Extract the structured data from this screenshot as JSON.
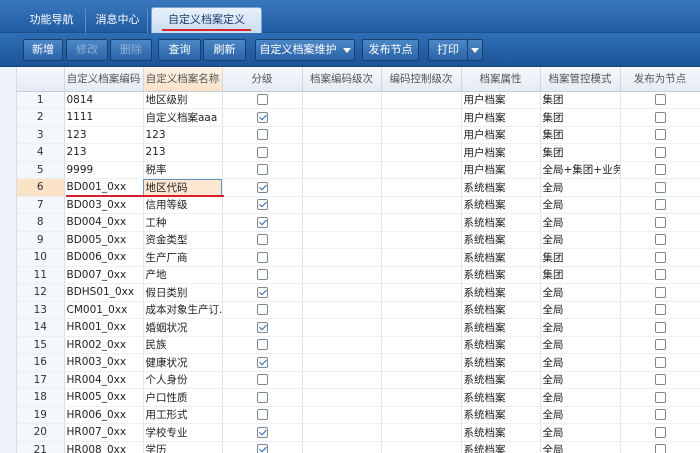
{
  "tabs": [
    {
      "label": "功能导航"
    },
    {
      "label": "消息中心"
    },
    {
      "label": "自定义档案定义"
    }
  ],
  "toolbar": {
    "add": "新增",
    "edit": "修改",
    "delete": "删除",
    "query": "查询",
    "refresh": "刷新",
    "maintain": "自定义档案维护",
    "publish": "发布节点",
    "print": "打印"
  },
  "columns": [
    "自定义档案编码",
    "自定义档案名称",
    "分级",
    "档案编码级次",
    "编码控制级次",
    "档案属性",
    "档案管控模式",
    "发布为节点"
  ],
  "rows": [
    {
      "no": "1",
      "code": "0814",
      "name": "地区级别",
      "grade": false,
      "attr": "用户档案",
      "mode": "集团",
      "publish": false
    },
    {
      "no": "2",
      "code": "1111",
      "name": "自定义档案aaa",
      "grade": true,
      "attr": "用户档案",
      "mode": "集团",
      "publish": false
    },
    {
      "no": "3",
      "code": "123",
      "name": "123",
      "grade": false,
      "attr": "用户档案",
      "mode": "集团",
      "publish": false
    },
    {
      "no": "4",
      "code": "213",
      "name": "213",
      "grade": false,
      "attr": "用户档案",
      "mode": "集团",
      "publish": false
    },
    {
      "no": "5",
      "code": "9999",
      "name": "税率",
      "grade": false,
      "attr": "用户档案",
      "mode": "全局+集团+业务...",
      "publish": false
    },
    {
      "no": "6",
      "code": "BD001_0xx",
      "name": "地区代码",
      "grade": true,
      "attr": "系统档案",
      "mode": "全局",
      "publish": false
    },
    {
      "no": "7",
      "code": "BD003_0xx",
      "name": "信用等级",
      "grade": true,
      "attr": "系统档案",
      "mode": "全局",
      "publish": false
    },
    {
      "no": "8",
      "code": "BD004_0xx",
      "name": "工种",
      "grade": true,
      "attr": "系统档案",
      "mode": "全局",
      "publish": false
    },
    {
      "no": "9",
      "code": "BD005_0xx",
      "name": "资金类型",
      "grade": false,
      "attr": "系统档案",
      "mode": "全局",
      "publish": false
    },
    {
      "no": "10",
      "code": "BD006_0xx",
      "name": "生产厂商",
      "grade": false,
      "attr": "系统档案",
      "mode": "集团",
      "publish": false
    },
    {
      "no": "11",
      "code": "BD007_0xx",
      "name": "产地",
      "grade": false,
      "attr": "系统档案",
      "mode": "集团",
      "publish": false
    },
    {
      "no": "12",
      "code": "BDHS01_0xx",
      "name": "假日类别",
      "grade": true,
      "attr": "系统档案",
      "mode": "全局",
      "publish": false
    },
    {
      "no": "13",
      "code": "CM001_0xx",
      "name": "成本对象生产订...",
      "grade": false,
      "attr": "系统档案",
      "mode": "全局",
      "publish": false
    },
    {
      "no": "14",
      "code": "HR001_0xx",
      "name": "婚姻状况",
      "grade": true,
      "attr": "系统档案",
      "mode": "全局",
      "publish": false
    },
    {
      "no": "15",
      "code": "HR002_0xx",
      "name": "民族",
      "grade": false,
      "attr": "系统档案",
      "mode": "全局",
      "publish": false
    },
    {
      "no": "16",
      "code": "HR003_0xx",
      "name": "健康状况",
      "grade": true,
      "attr": "系统档案",
      "mode": "全局",
      "publish": false
    },
    {
      "no": "17",
      "code": "HR004_0xx",
      "name": "个人身份",
      "grade": false,
      "attr": "系统档案",
      "mode": "全局",
      "publish": false
    },
    {
      "no": "18",
      "code": "HR005_0xx",
      "name": "户口性质",
      "grade": false,
      "attr": "系统档案",
      "mode": "全局",
      "publish": false
    },
    {
      "no": "19",
      "code": "HR006_0xx",
      "name": "用工形式",
      "grade": false,
      "attr": "系统档案",
      "mode": "全局",
      "publish": false
    },
    {
      "no": "20",
      "code": "HR007_0xx",
      "name": "学校专业",
      "grade": true,
      "attr": "系统档案",
      "mode": "全局",
      "publish": false
    },
    {
      "no": "21",
      "code": "HR008_0xx",
      "name": "学历",
      "grade": true,
      "attr": "系统档案",
      "mode": "全局",
      "publish": false
    }
  ],
  "selected_row": "6",
  "colors": {
    "header_blue": "#2f6fb5",
    "active_tab": "#c9dcf2",
    "selected_row": "#fde7d2",
    "annotation_red": "#d8202a"
  }
}
